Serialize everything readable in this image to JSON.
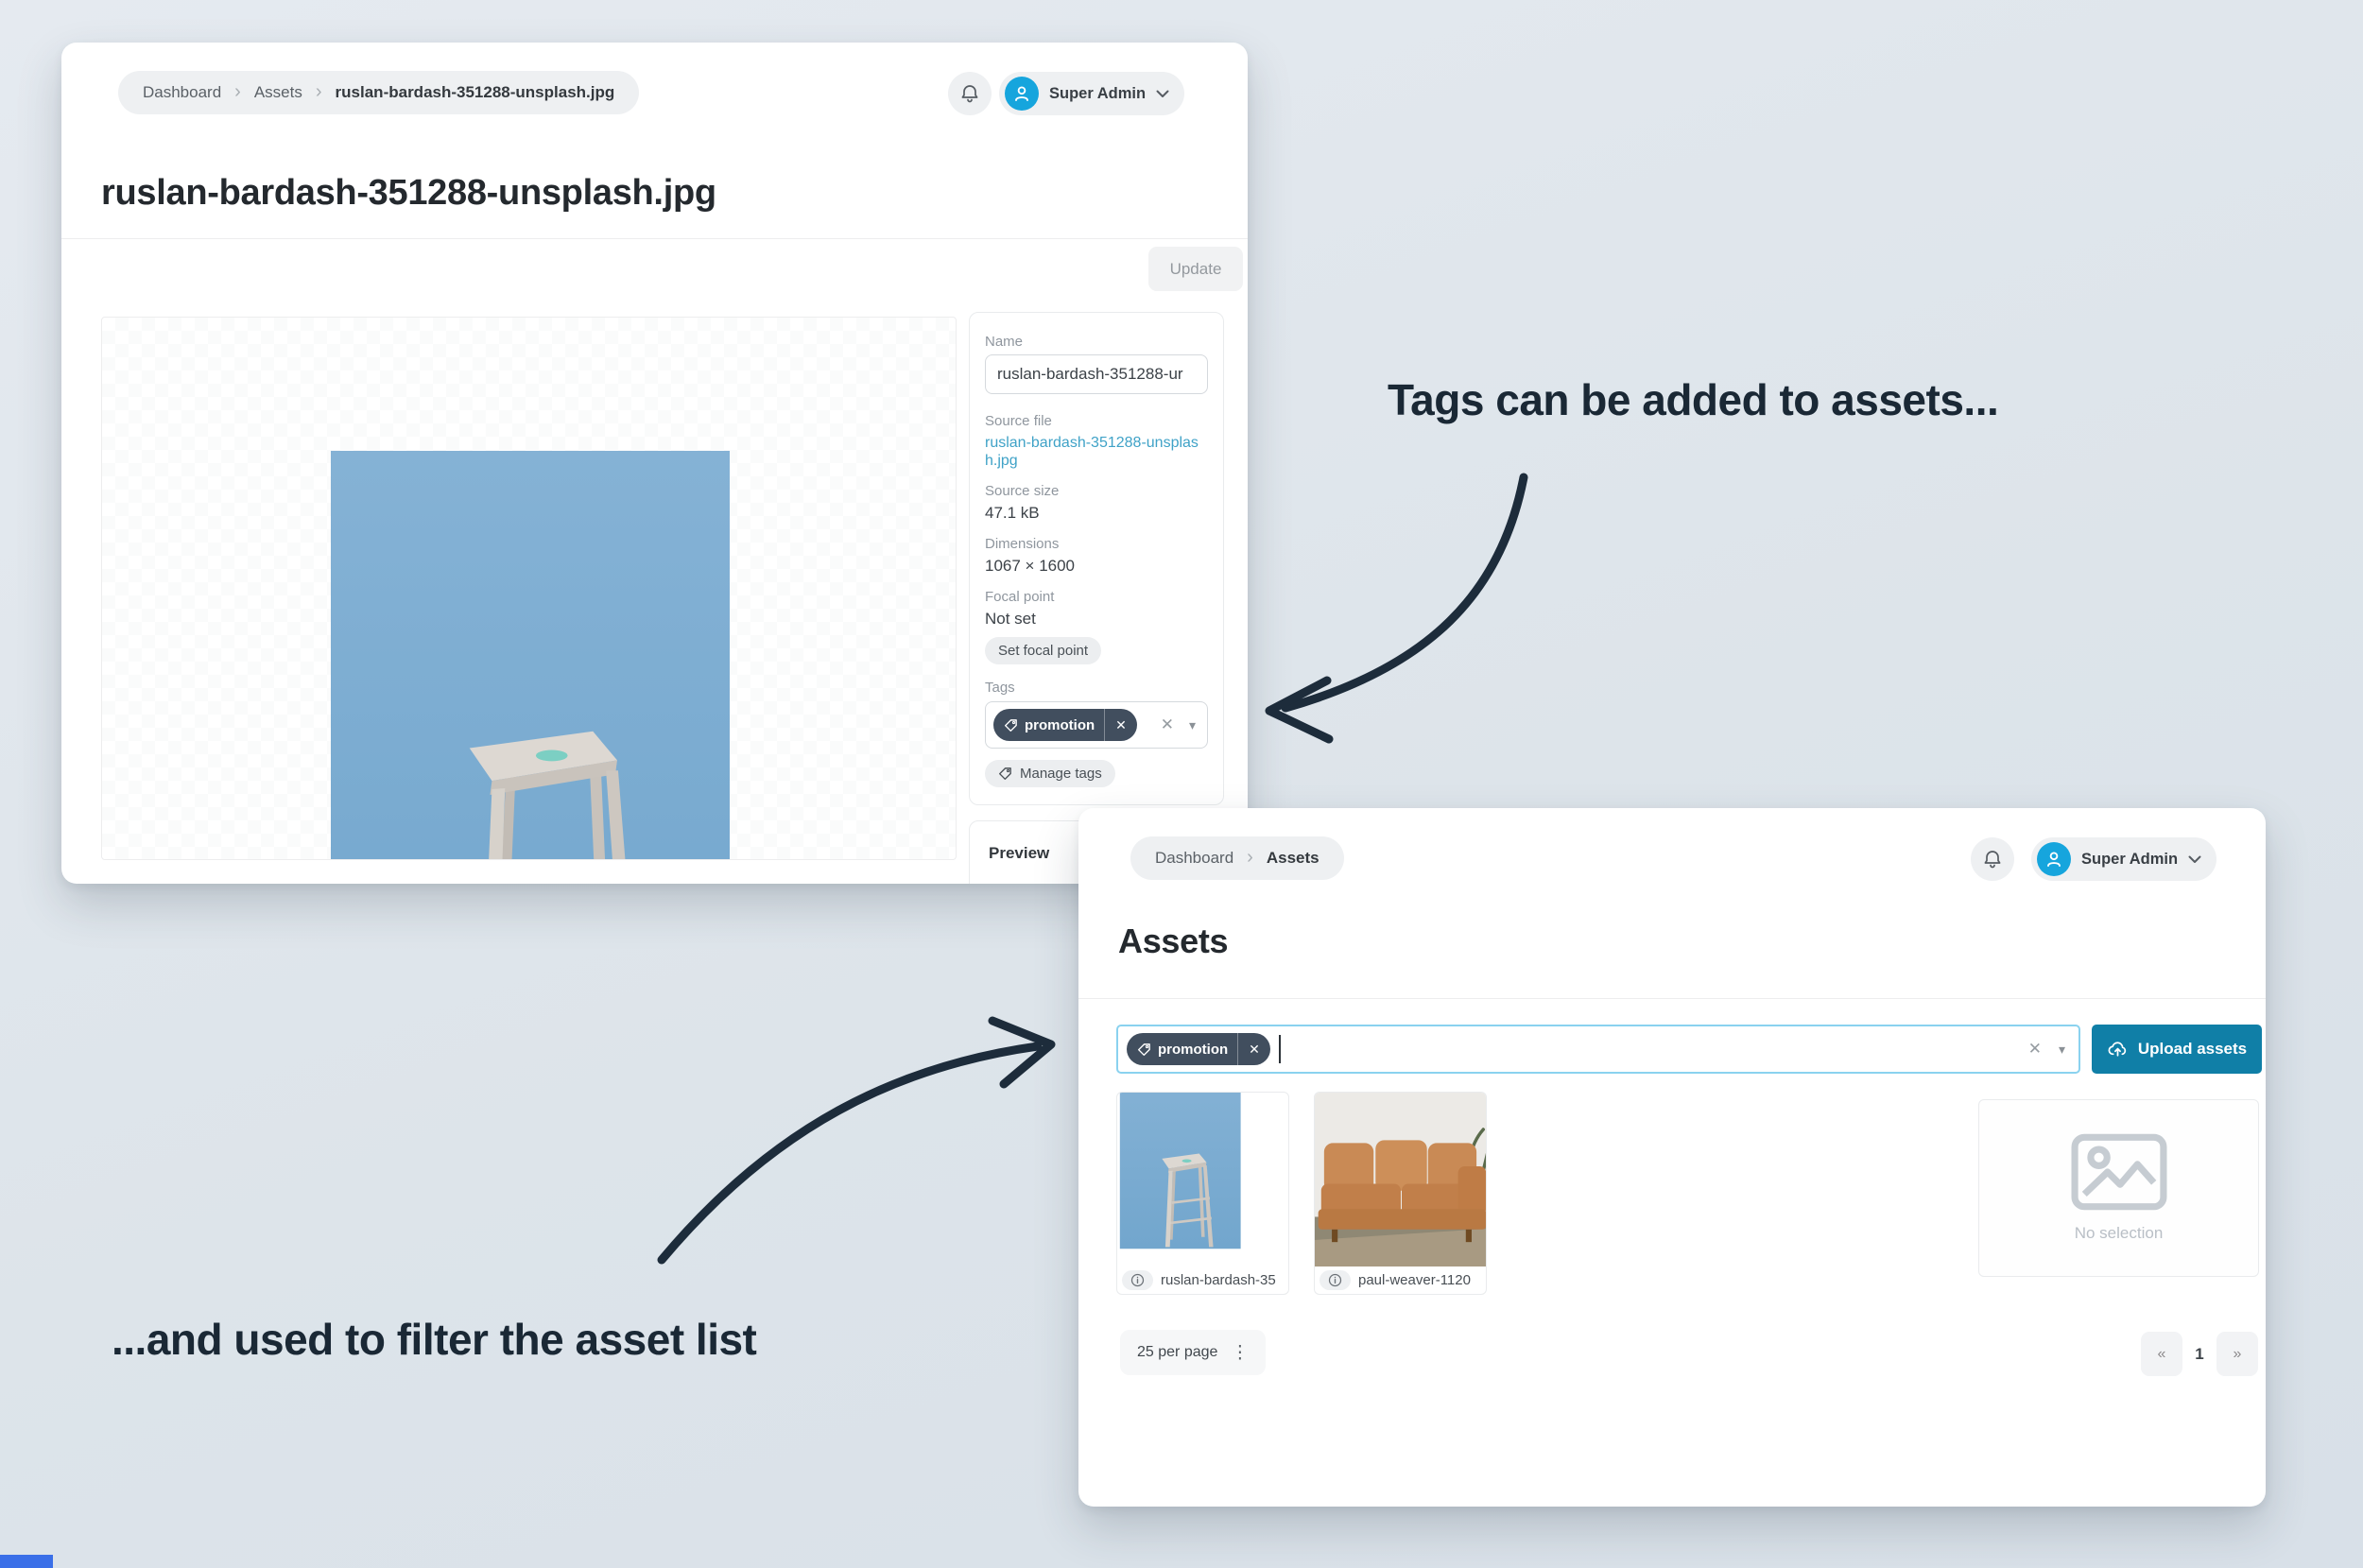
{
  "glyphs": {
    "chevron": "›",
    "close": "✕",
    "caret": "▾",
    "kebab": "⋮",
    "prev": "«",
    "next": "»"
  },
  "colors": {
    "accent_blue": "#107fa7",
    "avatar_blue": "#16a5dd",
    "tag_chip_bg": "#414e5e",
    "link": "#3fa2c7",
    "focus_border": "#8ad2ef",
    "annotation_ink": "#1a2835"
  },
  "annotations": {
    "tags_note": "Tags can be added to assets...",
    "filter_note": "...and used to filter the asset list"
  },
  "detail_window": {
    "breadcrumb": {
      "items": [
        "Dashboard",
        "Assets",
        "ruslan-bardash-351288-unsplash.jpg"
      ]
    },
    "user_menu": {
      "label": "Super Admin"
    },
    "page_title": "ruslan-bardash-351288-unsplash.jpg",
    "update_button": "Update",
    "fields": {
      "name_label": "Name",
      "name_value": "ruslan-bardash-351288-ur",
      "source_file_label": "Source file",
      "source_file_link": "ruslan-bardash-351288-unsplash.jpg",
      "source_size_label": "Source size",
      "source_size_value": "47.1 kB",
      "dimensions_label": "Dimensions",
      "dimensions_value": "1067 × 1600",
      "focal_label": "Focal point",
      "focal_value": "Not set",
      "set_focal_button": "Set focal point",
      "tags_label": "Tags",
      "tag_chip": "promotion",
      "manage_tags_button": "Manage tags"
    },
    "preview_section_label": "Preview"
  },
  "list_window": {
    "breadcrumb": {
      "items": [
        "Dashboard",
        "Assets"
      ]
    },
    "user_menu": {
      "label": "Super Admin"
    },
    "page_title": "Assets",
    "filter": {
      "tag_chip": "promotion"
    },
    "upload_button": "Upload assets",
    "assets": [
      {
        "filename": "ruslan-bardash-35"
      },
      {
        "filename": "paul-weaver-1120"
      }
    ],
    "no_selection_label": "No selection",
    "per_page_label": "25 per page",
    "pagination": {
      "prev": "«",
      "page": "1",
      "next": "»"
    }
  }
}
